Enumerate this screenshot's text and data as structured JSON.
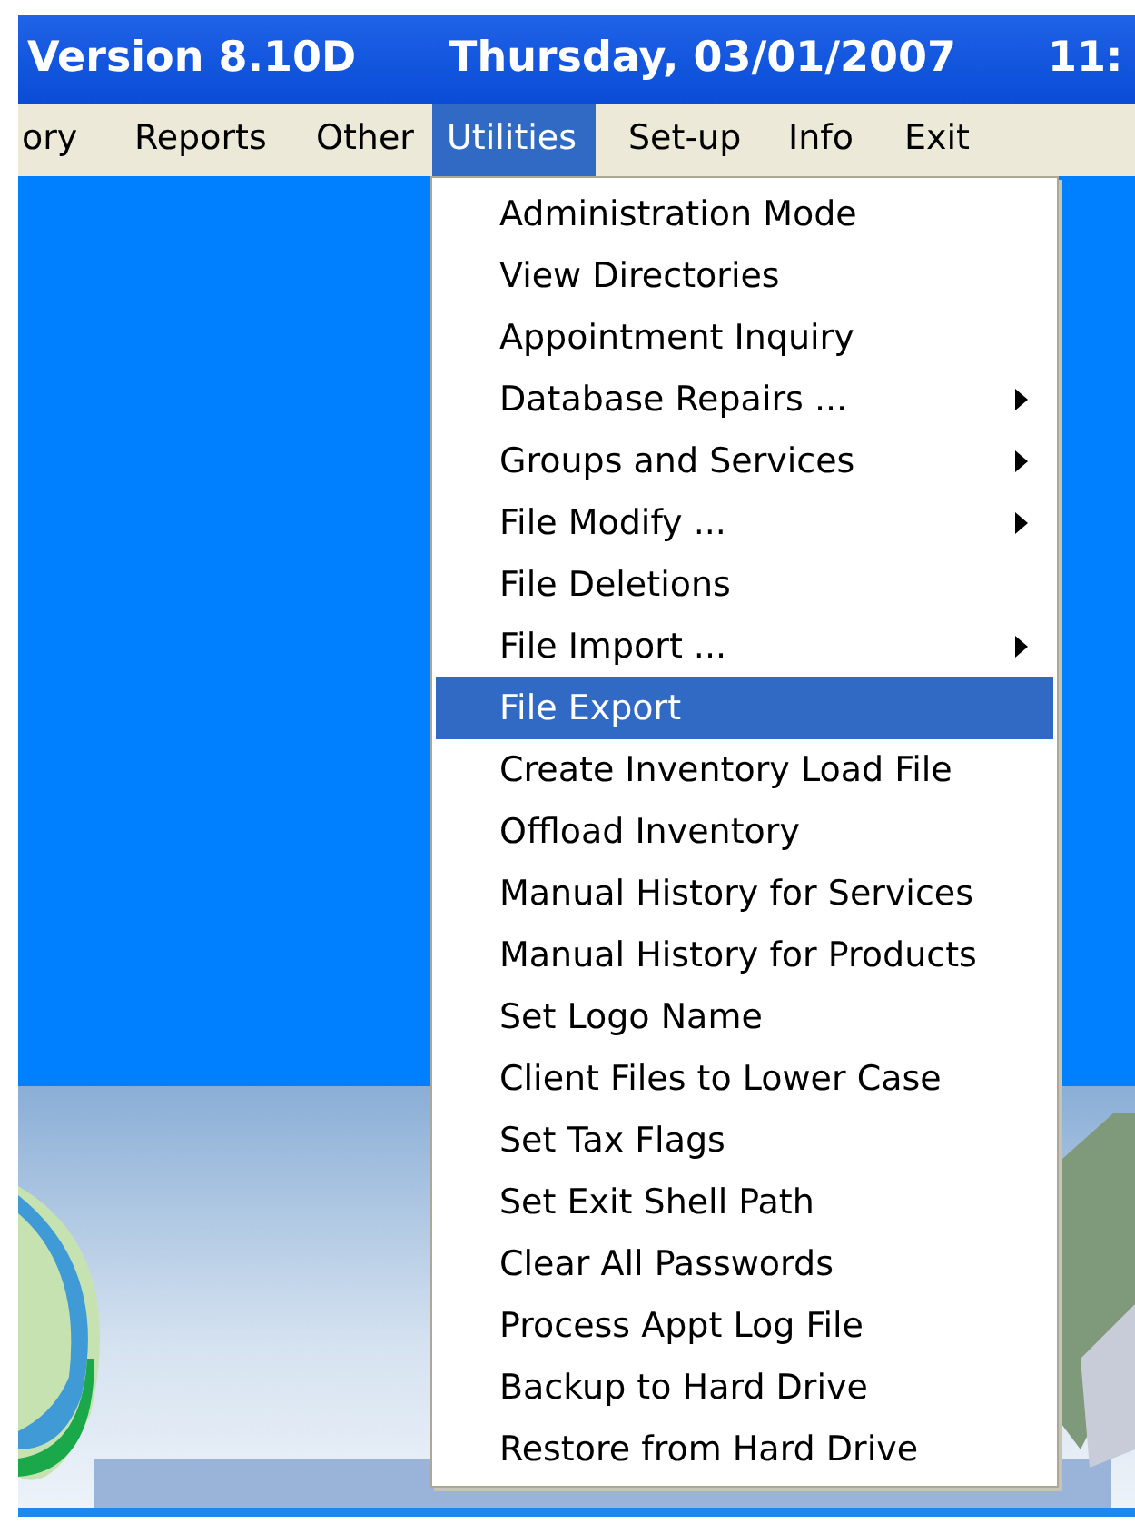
{
  "title_bar": {
    "texts": [
      "Version 8.10D",
      "Thursday, 03/01/2007",
      "11:"
    ]
  },
  "menu_bar": [
    {
      "label": "ory",
      "selected": false
    },
    {
      "label": "Reports",
      "selected": false
    },
    {
      "label": "Other",
      "selected": false
    },
    {
      "label": "Utilities",
      "selected": true
    },
    {
      "label": "Set-up",
      "selected": false
    },
    {
      "label": "Info",
      "selected": false
    },
    {
      "label": "Exit",
      "selected": false
    }
  ],
  "utilities_menu": [
    {
      "label": "Administration Mode",
      "selected": false,
      "has_submenu": false
    },
    {
      "label": "View Directories",
      "selected": false,
      "has_submenu": false
    },
    {
      "label": "Appointment Inquiry",
      "selected": false,
      "has_submenu": false
    },
    {
      "label": "Database Repairs ...",
      "selected": false,
      "has_submenu": true
    },
    {
      "label": "Groups and Services",
      "selected": false,
      "has_submenu": true
    },
    {
      "label": "File Modify ...",
      "selected": false,
      "has_submenu": true
    },
    {
      "label": "File Deletions",
      "selected": false,
      "has_submenu": false
    },
    {
      "label": "File Import ...",
      "selected": false,
      "has_submenu": true
    },
    {
      "label": "File Export",
      "selected": true,
      "has_submenu": false
    },
    {
      "label": "Create Inventory Load File",
      "selected": false,
      "has_submenu": false
    },
    {
      "label": "Offload Inventory",
      "selected": false,
      "has_submenu": false
    },
    {
      "label": "Manual History for Services",
      "selected": false,
      "has_submenu": false
    },
    {
      "label": "Manual History for Products",
      "selected": false,
      "has_submenu": false
    },
    {
      "label": "Set Logo Name",
      "selected": false,
      "has_submenu": false
    },
    {
      "label": "Client Files to Lower Case",
      "selected": false,
      "has_submenu": false
    },
    {
      "label": "Set Tax Flags",
      "selected": false,
      "has_submenu": false
    },
    {
      "label": "Set Exit Shell Path",
      "selected": false,
      "has_submenu": false
    },
    {
      "label": "Clear All Passwords",
      "selected": false,
      "has_submenu": false
    },
    {
      "label": "Process Appt Log File",
      "selected": false,
      "has_submenu": false
    },
    {
      "label": "Backup to Hard Drive",
      "selected": false,
      "has_submenu": false
    },
    {
      "label": "Restore from Hard Drive",
      "selected": false,
      "has_submenu": false
    }
  ]
}
